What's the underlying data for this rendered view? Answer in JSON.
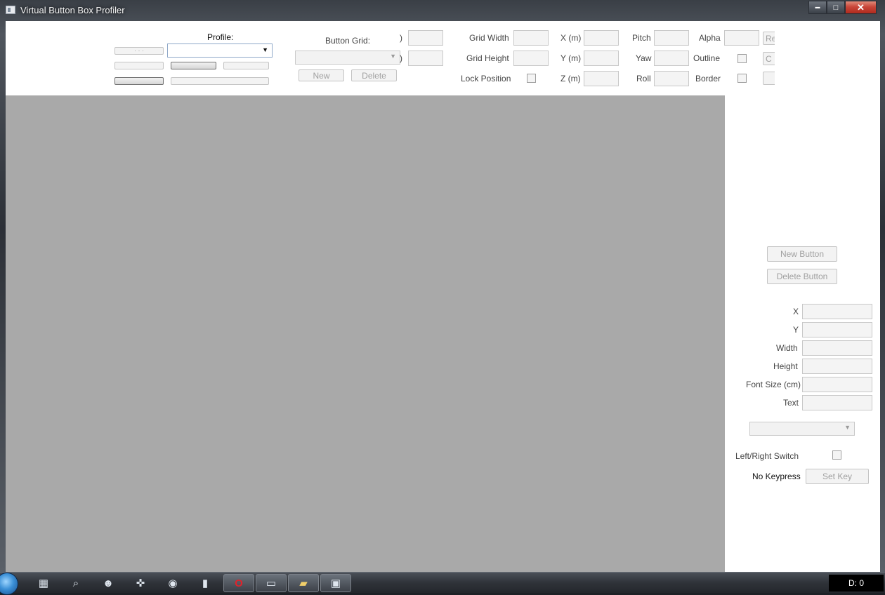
{
  "window": {
    "title": "Virtual Button Box Profiler",
    "minimize": "▬",
    "maximize": "□",
    "close": "✕"
  },
  "toolbar": {
    "profile_label": "Profile:",
    "button_grid_label": "Button Grid:",
    "profile_buttons_row1": "·  ·  ·",
    "grid_new": "New",
    "grid_delete": "Delete",
    "clipped_label_1": ")",
    "clipped_label_2": ")",
    "grid_width_label": "Grid Width",
    "grid_height_label": "Grid Height",
    "lock_position_label": "Lock Position",
    "x_label": "X (m)",
    "y_label": "Y (m)",
    "z_label": "Z (m)",
    "pitch_label": "Pitch",
    "yaw_label": "Yaw",
    "roll_label": "Roll",
    "alpha_label": "Alpha",
    "outline_label": "Outline",
    "border_label": "Border",
    "clipped_button_1": "Re",
    "clipped_button_2": "C"
  },
  "panel": {
    "new_button": "New Button",
    "delete_button": "Delete Button",
    "x_label": "X",
    "y_label": "Y",
    "width_label": "Width",
    "height_label": "Height",
    "font_size_label": "Font Size (cm)",
    "text_label": "Text",
    "left_right_switch_label": "Left/Right Switch",
    "no_keypress": "No Keypress",
    "set_key": "Set Key"
  },
  "taskbar": {
    "items": [
      "calculator-icon",
      "search-icon",
      "octopus-icon",
      "gamepad-icon",
      "network-icon",
      "chart-icon",
      "opera-icon",
      "display-icon",
      "folder-icon",
      "profiler-icon"
    ],
    "tray_text": "D: 0"
  }
}
